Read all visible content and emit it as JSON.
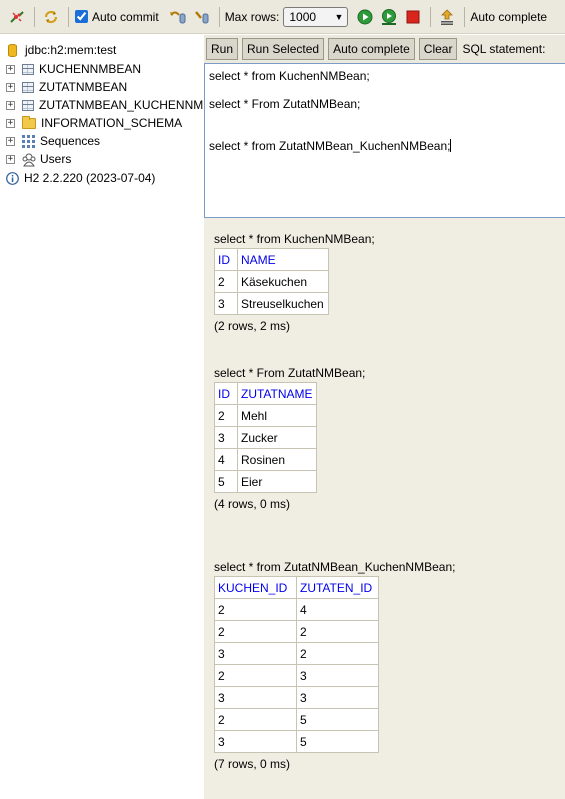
{
  "toolbar": {
    "auto_commit_label": "Auto commit",
    "auto_commit_checked": true,
    "max_rows_label": "Max rows:",
    "max_rows_value": "1000",
    "auto_complete_label": "Auto complete"
  },
  "tree": {
    "connection": "jdbc:h2:mem:test",
    "tables": [
      "KUCHENNMBEAN",
      "ZUTATNMBEAN",
      "ZUTATNMBEAN_KUCHENNM"
    ],
    "schema": "INFORMATION_SCHEMA",
    "sequences": "Sequences",
    "users": "Users",
    "version": "H2 2.2.220 (2023-07-04)"
  },
  "query_bar": {
    "run": "Run",
    "run_selected": "Run Selected",
    "auto_complete": "Auto complete",
    "clear": "Clear",
    "sql_statement_label": "SQL statement:"
  },
  "sql": {
    "line1": "select * from KuchenNMBean;",
    "line2": "select * From ZutatNMBean;",
    "line3": "select * from ZutatNMBean_KuchenNMBean;"
  },
  "results": [
    {
      "query": "select * from KuchenNMBean;",
      "columns": [
        "ID",
        "NAME"
      ],
      "rows": [
        [
          "2",
          "Käsekuchen"
        ],
        [
          "3",
          "Streuselkuchen"
        ]
      ],
      "footer": "(2 rows, 2 ms)"
    },
    {
      "query": "select * From ZutatNMBean;",
      "columns": [
        "ID",
        "ZUTATNAME"
      ],
      "rows": [
        [
          "2",
          "Mehl"
        ],
        [
          "3",
          "Zucker"
        ],
        [
          "4",
          "Rosinen"
        ],
        [
          "5",
          "Eier"
        ]
      ],
      "footer": "(4 rows, 0 ms)"
    },
    {
      "query": "select * from ZutatNMBean_KuchenNMBean;",
      "columns": [
        "KUCHEN_ID",
        "ZUTATEN_ID"
      ],
      "rows": [
        [
          "2",
          "4"
        ],
        [
          "2",
          "2"
        ],
        [
          "3",
          "2"
        ],
        [
          "2",
          "3"
        ],
        [
          "3",
          "3"
        ],
        [
          "2",
          "5"
        ],
        [
          "3",
          "5"
        ]
      ],
      "footer": "(7 rows, 0 ms)"
    }
  ]
}
